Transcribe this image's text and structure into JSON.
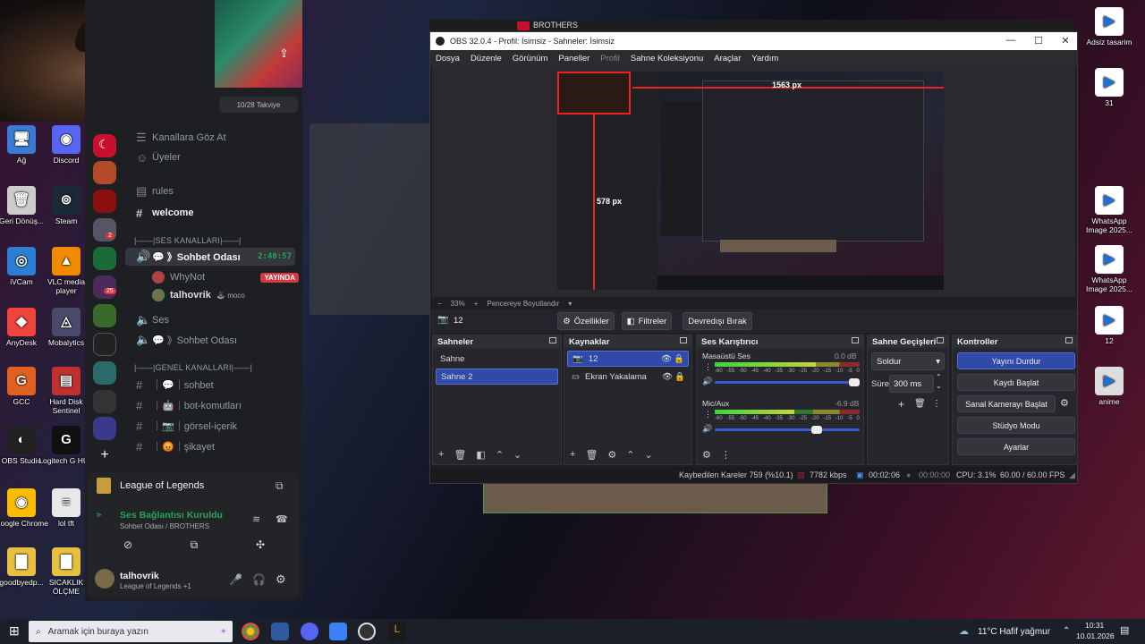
{
  "desktop": {
    "left_icons": [
      {
        "label": "Ağ"
      },
      {
        "label": "Discord"
      },
      {
        "label": "Geri Dönüş..."
      },
      {
        "label": "Steam"
      },
      {
        "label": "iVCam"
      },
      {
        "label": "VLC media player"
      },
      {
        "label": "AnyDesk"
      },
      {
        "label": "Mobalytics"
      },
      {
        "label": "GCC"
      },
      {
        "label": "Hard Disk Sentinel"
      },
      {
        "label": "OBS Studio"
      },
      {
        "label": "Logitech G HUB"
      },
      {
        "label": "Google Chrome"
      },
      {
        "label": "lol tft"
      },
      {
        "label": "goodbyedp..."
      },
      {
        "label": "SICAKLIK ÖLÇME"
      }
    ],
    "right_icons": [
      {
        "label": "Adsiz tasarim"
      },
      {
        "label": "31"
      },
      {
        "label": "WhatsApp Image 2025..."
      },
      {
        "label": "WhatsApp Image 2025..."
      },
      {
        "label": "12"
      },
      {
        "label": "anime"
      }
    ]
  },
  "discord": {
    "boost_label": "10/28 Takviye",
    "browse_channels": "Kanallara Göz At",
    "members": "Üyeler",
    "channel_rules": "rules",
    "channel_welcome": "welcome",
    "voice_category": "|——|SES KANALLARI|——|",
    "voice_channel_active": "💬 》Sohbet Odası",
    "voice_timer": "2:40:57",
    "user_whynot": "WhyNot",
    "live_badge": "YAYINDA",
    "user_talhovrik": "talhovrik",
    "user_moco": "moco",
    "channel_ses": "Ses",
    "voice_channel_2": "💬 》Sohbet Odası",
    "general_category": "|——|GENEL KANALLARI|——|",
    "text_channels": [
      "｜💬｜sohbet",
      "｜🤖｜bot-komutları",
      "｜📷｜görsel-içerik",
      "｜😡｜şikayet"
    ],
    "activity_title": "League of Legends",
    "voice_status": "Ses Bağlantısı Kuruldu",
    "voice_location": "Sohbet Odası / BROTHERS",
    "self_name": "talhovrik",
    "self_status": "League of Legends +1",
    "server_badges": [
      "2",
      "25"
    ]
  },
  "brothers_title": "BROTHERS",
  "obs": {
    "title": "OBS 32.0.4 - Profil: İsimsiz - Sahneler: İsimsiz",
    "menu": [
      "Dosya",
      "Düzenle",
      "Görünüm",
      "Paneller",
      "Profil",
      "Sahne Koleksiyonu",
      "Araçlar",
      "Yardım"
    ],
    "preview_labels": {
      "width": "1563 px",
      "height": "578 px"
    },
    "zoom": "33%",
    "fit_label": "Pencereye Boyutlandır",
    "context_source": "12",
    "context_buttons": {
      "properties": "Özellikler",
      "filters": "Filtreler",
      "deactivate": "Devredışı Bırak"
    },
    "scenes_title": "Sahneler",
    "scenes": [
      "Sahne",
      "Sahne 2"
    ],
    "sources_title": "Kaynaklar",
    "sources": [
      "12",
      "Ekran Yakalama"
    ],
    "mixer_title": "Ses Karıştırıcı",
    "mixer": [
      {
        "name": "Masaüstü Ses",
        "db": "0.0 dB",
        "level": 0.7
      },
      {
        "name": "Mic/Aux",
        "db": "-6.9 dB",
        "level": 0.55
      }
    ],
    "meter_scale": [
      "-60",
      "-55",
      "-50",
      "-45",
      "-40",
      "-35",
      "-30",
      "-25",
      "-20",
      "-15",
      "-10",
      "-5",
      "0"
    ],
    "transitions_title": "Sahne Geçişleri",
    "transition": "Soldur",
    "duration_label": "Süre",
    "duration": "300 ms",
    "controls_title": "Kontroller",
    "controls": [
      "Yayını Durdur",
      "Kaydı Başlat",
      "Sanal Kamerayı Başlat",
      "Stüdyo Modu",
      "Ayarlar"
    ],
    "status": {
      "dropped": "Kaybedilen Kareler 759 (%10.1)",
      "bitrate": "7782 kbps",
      "stream_time": "00:02:06",
      "rec_time": "00:00:00",
      "cpu": "CPU: 3.1%",
      "fps": "60.00 / 60.00 FPS"
    }
  },
  "taskbar": {
    "search_placeholder": "Aramak için buraya yazın",
    "weather": "11°C  Hafif yağmur",
    "time": "10:31",
    "date": "10.01.2026"
  }
}
